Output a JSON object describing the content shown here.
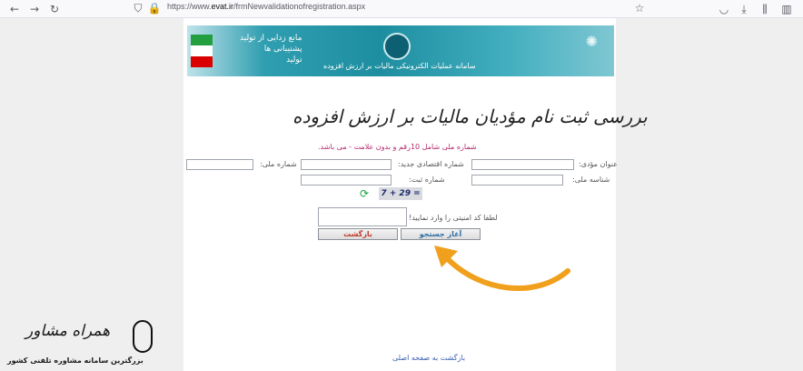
{
  "browser": {
    "url_prefix": "https://www.",
    "url_domain": "evat.ir",
    "url_path": "/frmNewvalidationofregistration.aspx"
  },
  "banner": {
    "system_name": "سامانه عملیات الکترونیکی مالیات بر ارزش افزوده",
    "slogan_line1": "مانع زدایی از تولید",
    "slogan_line2": "پشتیبانی ها",
    "slogan_line3": "تولید"
  },
  "page": {
    "title": "بررسی ثبت نام مؤدیان مالیات بر ارزش افزوده",
    "note": "شماره ملی شامل 10رقم و بدون علامت - می باشد."
  },
  "form": {
    "taxpayer_title_label": "عنوان مؤدی:",
    "new_economic_code_label": "شماره اقتصادی جدید:",
    "national_number_label": "شماره ملی:",
    "national_id_label": "شناسه ملی:",
    "registration_number_label": "شماره ثبت:",
    "captcha_text": "7 + 29 =",
    "captcha_prompt": "لطفا کد امنیتی را وارد نمایید!",
    "search_button": "آغاز جستجو",
    "back_button": "بازگشت"
  },
  "footer": {
    "home_link": "بازگشت به صفحه اصلی"
  },
  "watermark": {
    "brand": "همراه مشاور",
    "tagline": "بزرگترین سامانه مشاوره تلفنی کشور"
  },
  "colors": {
    "note": "#b4286b",
    "search_button_text": "#2e6da4",
    "back_button_text": "#c0392b",
    "arrow": "#f0a01c"
  }
}
